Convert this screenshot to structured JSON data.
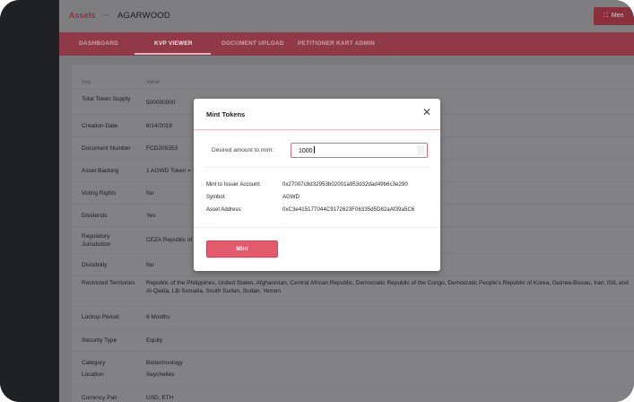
{
  "header": {
    "breadcrumb_root": "Assets",
    "breadcrumb_arrow": "→",
    "breadcrumb_current": "AGARWOOD",
    "menu_label": "Men"
  },
  "tabs": [
    {
      "label": "DASHBOARD"
    },
    {
      "label": "KVP VIEWER"
    },
    {
      "label": "DOCUMENT UPLOAD"
    },
    {
      "label": "PETITIONER KART ADMIN"
    }
  ],
  "table": {
    "key_header": "Key",
    "value_header": "Value",
    "rows": [
      {
        "key": "Total Token Supply",
        "value": "500000000"
      },
      {
        "key": "Creation Date",
        "value": "6/14/2019"
      },
      {
        "key": "Document Number",
        "value": "FCD205353"
      },
      {
        "key": "Asset Backing",
        "value": "1 AGWD Token = 1 g"
      },
      {
        "key": "Voting Rights",
        "value": "No"
      },
      {
        "key": "Dividends",
        "value": "Yes"
      },
      {
        "key": "Regulatory Jurisdiction",
        "value": "CEZA Republic of th"
      },
      {
        "key": "Divisibility",
        "value": "No"
      },
      {
        "key": "Restricted Territories",
        "value": "Republic of the Philippines, United States, Afghanistan, Central African Republic, Democratic Republic of the Congo, Democratic People's Republic of Korea, Guinea-Bissau, Iran, ISIL and Al-Qaida, Lib Somalia, South Sudan, Sudan, Yemen"
      },
      {
        "key": "Lockup Period",
        "value": "6 Months"
      },
      {
        "key": "Security Type",
        "value": "Equity"
      },
      {
        "key": "Category",
        "value": "Biotechnology"
      },
      {
        "key": "Location",
        "value": "Seychelles"
      },
      {
        "key": "Currency Pair",
        "value": "USD, ETH"
      }
    ]
  },
  "modal": {
    "title": "Mint Tokens",
    "close_glyph": "✕",
    "amount_label": "Desired amount to mint:",
    "amount_value": "1000",
    "info": [
      {
        "label": "Mint to Issuer Account:",
        "value": "0x27007c8d32953b02001a953d32dad49b6c3e290"
      },
      {
        "label": "Symbol:",
        "value": "AGWD"
      },
      {
        "label": "Asset Address:",
        "value": "0xC3e415177044C9172623F06335d5D82aAf39a5C6"
      }
    ],
    "mint_label": "Mint"
  },
  "colors": {
    "accent": "#e25a6c",
    "overlay_tab_bar": "#8f3a46",
    "modal_border": "#e06a7b"
  }
}
